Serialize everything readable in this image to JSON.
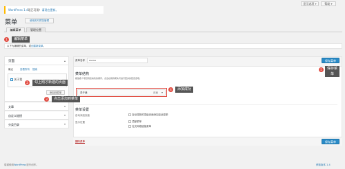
{
  "top_right": {
    "screen_options": "显示选项",
    "help": "帮助"
  },
  "notice": {
    "version_link": "WordPress 1.4",
    "text": "现已可用！",
    "update_link": "请现在更新。"
  },
  "page_title": "菜单",
  "live_manage_button": "使用实时预览管理",
  "tabs": [
    {
      "label": "编辑菜单"
    },
    {
      "label": "管理位置"
    }
  ],
  "hint": {
    "text": "以下为编辑的菜单，或",
    "link": "创建新菜单",
    "suffix": "。"
  },
  "left": {
    "pages_title": "页面",
    "subtabs": [
      "最近",
      "查看所有",
      "搜索"
    ],
    "checkbox_label": "关于我",
    "add_button": "添加到菜单",
    "sections": [
      "文章",
      "自定义链接",
      "分类目录"
    ]
  },
  "menu_name_label": "菜单名称",
  "menu_name_value": "menu",
  "save_menu": "保存菜单",
  "structure": {
    "title": "菜单结构",
    "description": "拖放各个项目到您喜欢的顺序，点击右侧的箭头可进行更多的配置选项。"
  },
  "menu_item": {
    "label": "关于我",
    "type": "页面"
  },
  "settings": {
    "title": "菜单设置",
    "auto_add_label": "自动添加页面",
    "auto_add_option": "自动将新的顶级页面添加至此菜单",
    "location_label": "显示位置",
    "locations": [
      "顶部菜单",
      "社交网络链接菜单"
    ]
  },
  "delete_menu": "删除菜单",
  "footer": {
    "thanks": "感谢使用",
    "wp_link": "WordPress",
    "suffix": "进行创作。",
    "version": "获取版本 1.4"
  },
  "annotations": [
    {
      "num": "1",
      "text": "编辑菜单"
    },
    {
      "num": "2",
      "text": "勾上刚才新建的页面"
    },
    {
      "num": "3",
      "text": "点击添加到菜单"
    },
    {
      "num": "4",
      "text": "添加成功"
    },
    {
      "num": "5",
      "text": "保存菜",
      "text2": "单"
    }
  ],
  "colors": {
    "accent": "#2a8bc7",
    "annotation": "#e14d43",
    "tooltip": "#555555",
    "highlight_border": "#e14d43"
  }
}
